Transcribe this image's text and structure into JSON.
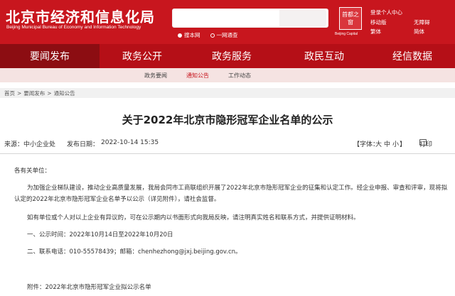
{
  "header": {
    "title": "北京市经济和信息化局",
    "subtitle": "Beijing Municipal Bureau of Economy and Information Technology",
    "search_placeholder": "",
    "radio_site": "搜本网",
    "radio_all": "一网通查",
    "emblem_text": "首都之窗",
    "emblem_sub": "Beijing Capital",
    "login": "登录个人中心",
    "mobile": "移动版",
    "accessible": "无障碍",
    "traditional": "繁体",
    "simplified": "简体"
  },
  "nav": {
    "items": [
      "要闻发布",
      "政务公开",
      "政务服务",
      "政民互动",
      "经信数据"
    ],
    "active_index": 0,
    "sub_items": [
      "政务要闻",
      "通知公告",
      "工作动态"
    ],
    "sub_active_index": 1
  },
  "breadcrumb": {
    "items": [
      "首页",
      "要闻发布",
      "通知公告"
    ],
    "separator": ">"
  },
  "article": {
    "title": "关于2022年北京市隐形冠军企业名单的公示",
    "source_label": "来源：",
    "source": "中小企业处",
    "date_label": "发布日期：",
    "date": "2022-10-14 15:35",
    "font_size_label": "【字体：",
    "font_large": "大",
    "font_medium": "中",
    "font_small": "小",
    "font_close": "】",
    "print_label": "打印",
    "greeting": "各有关单位：",
    "para1_line1": "为加强企业梯队建设，推动企业高质量发展，我局会同市工商联组织开展了2022年北京市隐形冠军企业的征集和认定工作。经企业申报、审查和评审，现将拟",
    "para1_line2": "认定的2022年北京市隐形冠军企业名单予以公示（详见附件），请社会监督。",
    "para2": "如有单位或个人对以上企业有异议的，可在公示期内以书面形式向我局反映，请注明真实姓名和联系方式，并提供证明材料。",
    "item1": "一、公示时间：2022年10月14日至2022年10月20日",
    "item2": "二、联系电话：010-55578439；邮箱：chenhezhong@jxj.beijing.gov.cn。",
    "attachment": "附件：2022年北京市隐形冠军企业拟公示名单"
  }
}
